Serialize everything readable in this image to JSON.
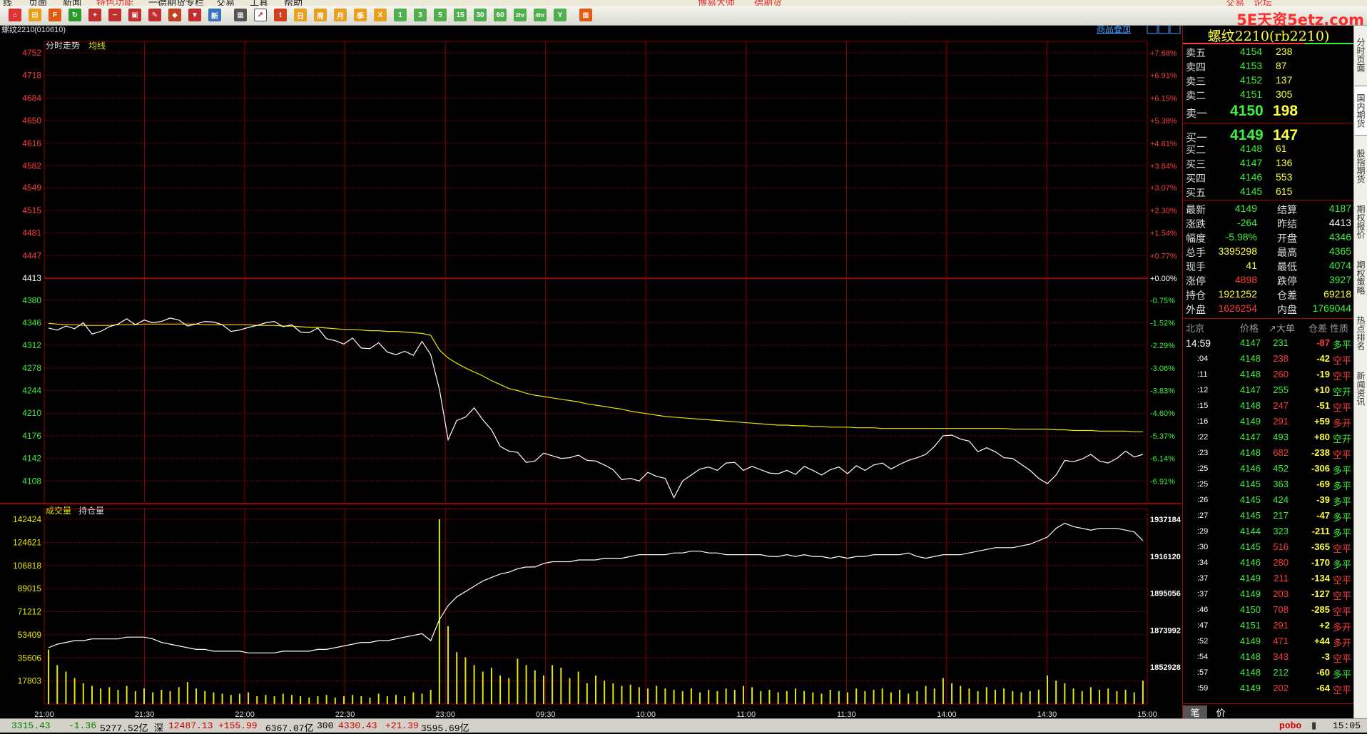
{
  "menubar": {
    "items": [
      "线",
      "页面",
      "新闻",
      "特色功能",
      "一德期货专栏",
      "交易",
      "工具",
      "帮助"
    ],
    "center": [
      "博易大师",
      "德期货"
    ],
    "right": [
      "交易",
      "论坛"
    ]
  },
  "toolbar": {
    "period_buttons": [
      "日",
      "周",
      "月",
      "季",
      "X",
      "1",
      "3",
      "5",
      "15",
      "30",
      "60",
      "2hr",
      "4hr",
      "Y"
    ],
    "watermark": "5E天资5etz.com"
  },
  "chart_header": {
    "symbol": "螺纹2210",
    "code": "(010610)",
    "overlay_link": "商品叠加",
    "price_pane_label": "分时走势",
    "avg_label": "均线",
    "volume_pane_label": "成交量",
    "oi_label": "持仓量"
  },
  "colors": {
    "up": "#ff3c3c",
    "down": "#3df03d",
    "grid": "#8b0000",
    "price_line": "#ffffff",
    "avg_line": "#e6e600",
    "volume_bar": "#e6e600"
  },
  "chart_data": [
    {
      "type": "line",
      "title": "分时走势",
      "x_ticks": [
        "21:00",
        "21:30",
        "22:00",
        "22:30",
        "23:00",
        "09:30",
        "10:00",
        "11:00",
        "11:30",
        "14:00",
        "14:30",
        "15:00"
      ],
      "y_ticks_left": [
        4752,
        4718,
        4684,
        4650,
        4616,
        4582,
        4549,
        4515,
        4481,
        4447,
        4413,
        4380,
        4346,
        4312,
        4278,
        4244,
        4210,
        4176,
        4142,
        4108
      ],
      "y_ticks_right": [
        "+7.68%",
        "+6.91%",
        "+6.15%",
        "+5.38%",
        "+4.61%",
        "+3.84%",
        "+3.07%",
        "+2.30%",
        "+1.54%",
        "+0.77%",
        "+0.00%",
        "-0.75%",
        "-1.52%",
        "-2.29%",
        "-3.06%",
        "-3.83%",
        "-4.60%",
        "-5.37%",
        "-6.14%",
        "-6.91%"
      ],
      "ylim": [
        4074,
        4752
      ],
      "reference": 4413,
      "series": [
        {
          "values": [
            4338,
            4335,
            4341,
            4337,
            4346,
            4329,
            4333,
            4340,
            4344,
            4352,
            4343,
            4350,
            4346,
            4348,
            4353,
            4350,
            4341,
            4344,
            4348,
            4347,
            4343,
            4333,
            4335,
            4339,
            4342,
            4346,
            4348,
            4340,
            4343,
            4332,
            4331,
            4338,
            4322,
            4319,
            4314,
            4323,
            4308,
            4307,
            4316,
            4302,
            4298,
            4303,
            4297,
            4318,
            4298,
            4246,
            4170,
            4199,
            4204,
            4218,
            4200,
            4185,
            4160,
            4153,
            4151,
            4136,
            4138,
            4150,
            4146,
            4142,
            4143,
            4147,
            4139,
            4138,
            4132,
            4125,
            4110,
            4112,
            4108,
            4121,
            4115,
            4112,
            4083,
            4108,
            4117,
            4126,
            4129,
            4124,
            4135,
            4136,
            4124,
            4130,
            4125,
            4120,
            4119,
            4124,
            4118,
            4130,
            4124,
            4117,
            4125,
            4129,
            4119,
            4131,
            4124,
            4132,
            4135,
            4126,
            4133,
            4139,
            4143,
            4148,
            4160,
            4176,
            4177,
            4171,
            4168,
            4152,
            4158,
            4152,
            4143,
            4142,
            4133,
            4124,
            4112,
            4104,
            4117,
            4139,
            4137,
            4141,
            4148,
            4138,
            4135,
            4142,
            4153,
            4144,
            4148
          ]
        },
        {
          "values": [
            4345,
            4344,
            4343,
            4343,
            4342,
            4342,
            4342,
            4342,
            4343,
            4343,
            4343,
            4344,
            4344,
            4344,
            4344,
            4344,
            4344,
            4344,
            4343,
            4343,
            4343,
            4343,
            4343,
            4343,
            4342,
            4342,
            4342,
            4341,
            4341,
            4340,
            4339,
            4339,
            4338,
            4337,
            4336,
            4336,
            4335,
            4334,
            4334,
            4333,
            4333,
            4332,
            4331,
            4330,
            4327,
            4305,
            4293,
            4285,
            4278,
            4272,
            4266,
            4259,
            4253,
            4247,
            4244,
            4240,
            4237,
            4235,
            4233,
            4231,
            4229,
            4227,
            4224,
            4222,
            4220,
            4218,
            4216,
            4213,
            4211,
            4209,
            4207,
            4205,
            4204,
            4203,
            4202,
            4201,
            4200,
            4199,
            4198,
            4197,
            4196,
            4195,
            4194,
            4193,
            4192,
            4192,
            4191,
            4191,
            4190,
            4190,
            4189,
            4189,
            4189,
            4188,
            4188,
            4188,
            4187,
            4187,
            4187,
            4187,
            4187,
            4187,
            4187,
            4187,
            4187,
            4187,
            4187,
            4187,
            4187,
            4187,
            4187,
            4186,
            4186,
            4186,
            4186,
            4186,
            4185,
            4185,
            4184,
            4184,
            4184,
            4183,
            4183,
            4183,
            4183,
            4182,
            4182
          ]
        }
      ]
    },
    {
      "type": "bar",
      "title": "成交量",
      "y_ticks_left": [
        142424,
        124621,
        106818,
        89015,
        71212,
        53409,
        35606,
        17803
      ],
      "y_ticks_right": [
        1937184,
        1916120,
        1895056,
        1873992,
        1852928
      ],
      "ylim": [
        0,
        142424
      ],
      "oi_ylim": [
        1831864,
        1937184
      ],
      "series": [
        {
          "name": "成交量",
          "values": [
            42000,
            30000,
            25000,
            20000,
            16000,
            14000,
            12000,
            13000,
            11000,
            14000,
            10000,
            12000,
            9000,
            11000,
            10000,
            13000,
            17000,
            12000,
            10000,
            9000,
            8000,
            7000,
            8000,
            9000,
            6000,
            7000,
            6000,
            8000,
            7000,
            6000,
            5000,
            6000,
            7000,
            5000,
            6000,
            7000,
            6000,
            5000,
            8000,
            6000,
            7000,
            6000,
            9000,
            8000,
            11000,
            142424,
            60000,
            40000,
            36000,
            30000,
            25000,
            28000,
            22000,
            20000,
            35000,
            30000,
            26000,
            22000,
            30000,
            28000,
            20000,
            25000,
            16000,
            22000,
            18000,
            16000,
            14000,
            15000,
            13000,
            12000,
            14000,
            12000,
            11000,
            10000,
            12000,
            9000,
            11000,
            10000,
            12000,
            11000,
            14000,
            13000,
            10000,
            11000,
            9000,
            10000,
            12000,
            10000,
            9000,
            8000,
            11000,
            10000,
            9000,
            12000,
            10000,
            11000,
            12000,
            9000,
            11000,
            8000,
            10000,
            14000,
            12000,
            20000,
            16000,
            14000,
            12000,
            10000,
            13000,
            11000,
            12000,
            10000,
            9000,
            10000,
            11000,
            22000,
            18000,
            16000,
            12000,
            10000,
            13000,
            11000,
            12000,
            10000,
            11000,
            9000,
            18000
          ]
        },
        {
          "name": "持仓量",
          "values": [
            1864000,
            1866000,
            1867000,
            1868000,
            1868000,
            1869000,
            1869000,
            1869000,
            1869000,
            1870000,
            1870000,
            1870000,
            1869000,
            1867000,
            1866000,
            1865000,
            1864000,
            1863000,
            1863000,
            1862000,
            1862000,
            1862000,
            1862000,
            1861000,
            1861000,
            1861000,
            1861000,
            1862000,
            1862000,
            1862000,
            1862000,
            1863000,
            1863000,
            1864000,
            1865000,
            1866000,
            1867000,
            1867000,
            1868000,
            1868000,
            1869000,
            1870000,
            1871000,
            1872000,
            1868000,
            1880000,
            1888000,
            1893000,
            1896000,
            1899000,
            1902000,
            1904000,
            1906000,
            1907000,
            1909000,
            1910000,
            1910000,
            1912000,
            1913000,
            1913000,
            1913000,
            1914000,
            1914000,
            1914000,
            1915000,
            1915000,
            1915000,
            1916000,
            1917000,
            1917000,
            1917000,
            1917000,
            1918000,
            1918000,
            1919000,
            1919000,
            1918000,
            1918000,
            1917000,
            1917000,
            1917000,
            1917000,
            1917000,
            1916000,
            1916000,
            1917000,
            1916000,
            1917000,
            1916000,
            1916000,
            1915000,
            1916000,
            1915000,
            1916000,
            1916000,
            1917000,
            1917000,
            1917000,
            1917000,
            1918000,
            1916000,
            1915000,
            1916000,
            1917000,
            1917000,
            1917000,
            1918000,
            1919000,
            1920000,
            1921000,
            1921000,
            1921000,
            1922000,
            1923000,
            1925000,
            1927000,
            1932000,
            1935000,
            1933000,
            1932000,
            1931000,
            1932000,
            1932000,
            1932000,
            1931000,
            1930000,
            1925000
          ]
        }
      ]
    }
  ],
  "panel": {
    "title": "螺纹2210(rb2210)",
    "asks": [
      {
        "label": "卖五",
        "price": "4154",
        "vol": "238"
      },
      {
        "label": "卖四",
        "price": "4153",
        "vol": "87"
      },
      {
        "label": "卖三",
        "price": "4152",
        "vol": "137"
      },
      {
        "label": "卖二",
        "price": "4151",
        "vol": "305"
      },
      {
        "label": "卖一",
        "price": "4150",
        "vol": "198"
      }
    ],
    "bids": [
      {
        "label": "买一",
        "price": "4149",
        "vol": "147"
      },
      {
        "label": "买二",
        "price": "4148",
        "vol": "61"
      },
      {
        "label": "买三",
        "price": "4147",
        "vol": "136"
      },
      {
        "label": "买四",
        "price": "4146",
        "vol": "553"
      },
      {
        "label": "买五",
        "price": "4145",
        "vol": "615"
      }
    ],
    "stats": [
      {
        "l1": "最新",
        "v1": "4149",
        "c1": "g",
        "l2": "结算",
        "v2": "4187",
        "c2": "g"
      },
      {
        "l1": "涨跌",
        "v1": "-264",
        "c1": "g",
        "l2": "昨结",
        "v2": "4413",
        "c2": "w"
      },
      {
        "l1": "幅度",
        "v1": "-5.98%",
        "c1": "g",
        "l2": "开盘",
        "v2": "4346",
        "c2": "g"
      },
      {
        "l1": "总手",
        "v1": "3395298",
        "c1": "y",
        "l2": "最高",
        "v2": "4365",
        "c2": "g"
      },
      {
        "l1": "现手",
        "v1": "41",
        "c1": "y",
        "l2": "最低",
        "v2": "4074",
        "c2": "g"
      },
      {
        "l1": "涨停",
        "v1": "4898",
        "c1": "r",
        "l2": "跌停",
        "v2": "3927",
        "c2": "g"
      },
      {
        "l1": "持仓",
        "v1": "1921252",
        "c1": "y",
        "l2": "仓差",
        "v2": "69218",
        "c2": "y"
      },
      {
        "l1": "外盘",
        "v1": "1626254",
        "c1": "r",
        "l2": "内盘",
        "v2": "1769044",
        "c2": "g"
      }
    ],
    "tick_headers": [
      "北京",
      "价格",
      "↗大单",
      "仓差",
      "性质"
    ],
    "ticks": [
      {
        "t": "14:59",
        "p": "4147",
        "v": "231",
        "vc": "g",
        "d": "-87",
        "dc": "r",
        "n": "多平",
        "nc": "g"
      },
      {
        "t": ":04",
        "p": "4148",
        "v": "238",
        "vc": "r",
        "d": "-42",
        "dc": "y",
        "n": "空平",
        "nc": "r"
      },
      {
        "t": ":11",
        "p": "4148",
        "v": "260",
        "vc": "r",
        "d": "-19",
        "dc": "y",
        "n": "空平",
        "nc": "r"
      },
      {
        "t": ":12",
        "p": "4147",
        "v": "255",
        "vc": "g",
        "d": "+10",
        "dc": "y",
        "n": "空开",
        "nc": "g"
      },
      {
        "t": ":15",
        "p": "4148",
        "v": "247",
        "vc": "r",
        "d": "-51",
        "dc": "y",
        "n": "空平",
        "nc": "r"
      },
      {
        "t": ":16",
        "p": "4149",
        "v": "291",
        "vc": "r",
        "d": "+59",
        "dc": "y",
        "n": "多开",
        "nc": "r"
      },
      {
        "t": ":22",
        "p": "4147",
        "v": "493",
        "vc": "g",
        "d": "+80",
        "dc": "y",
        "n": "空开",
        "nc": "g"
      },
      {
        "t": ":23",
        "p": "4148",
        "v": "682",
        "vc": "r",
        "d": "-238",
        "dc": "y",
        "n": "空平",
        "nc": "r"
      },
      {
        "t": ":25",
        "p": "4146",
        "v": "452",
        "vc": "g",
        "d": "-306",
        "dc": "y",
        "n": "多平",
        "nc": "g"
      },
      {
        "t": ":25",
        "p": "4145",
        "v": "363",
        "vc": "g",
        "d": "-69",
        "dc": "y",
        "n": "多平",
        "nc": "g"
      },
      {
        "t": ":26",
        "p": "4145",
        "v": "424",
        "vc": "g",
        "d": "-39",
        "dc": "y",
        "n": "多平",
        "nc": "g"
      },
      {
        "t": ":27",
        "p": "4145",
        "v": "217",
        "vc": "g",
        "d": "-47",
        "dc": "y",
        "n": "多平",
        "nc": "g"
      },
      {
        "t": ":29",
        "p": "4144",
        "v": "323",
        "vc": "g",
        "d": "-211",
        "dc": "y",
        "n": "多平",
        "nc": "g"
      },
      {
        "t": ":30",
        "p": "4145",
        "v": "516",
        "vc": "r",
        "d": "-365",
        "dc": "y",
        "n": "空平",
        "nc": "r"
      },
      {
        "t": ":34",
        "p": "4146",
        "v": "280",
        "vc": "r",
        "d": "-170",
        "dc": "y",
        "n": "多平",
        "nc": "g"
      },
      {
        "t": ":37",
        "p": "4149",
        "v": "211",
        "vc": "r",
        "d": "-134",
        "dc": "y",
        "n": "空平",
        "nc": "r"
      },
      {
        "t": ":37",
        "p": "4149",
        "v": "203",
        "vc": "r",
        "d": "-127",
        "dc": "y",
        "n": "空平",
        "nc": "r"
      },
      {
        "t": ":46",
        "p": "4150",
        "v": "708",
        "vc": "r",
        "d": "-285",
        "dc": "y",
        "n": "空平",
        "nc": "r"
      },
      {
        "t": ":47",
        "p": "4151",
        "v": "291",
        "vc": "r",
        "d": "+2",
        "dc": "y",
        "n": "多开",
        "nc": "r"
      },
      {
        "t": ":52",
        "p": "4149",
        "v": "471",
        "vc": "r",
        "d": "+44",
        "dc": "y",
        "n": "多开",
        "nc": "r"
      },
      {
        "t": ":54",
        "p": "4148",
        "v": "343",
        "vc": "r",
        "d": "-3",
        "dc": "y",
        "n": "空平",
        "nc": "r"
      },
      {
        "t": ":57",
        "p": "4148",
        "v": "212",
        "vc": "g",
        "d": "-60",
        "dc": "y",
        "n": "多平",
        "nc": "g"
      },
      {
        "t": ":59",
        "p": "4149",
        "v": "202",
        "vc": "r",
        "d": "-64",
        "dc": "y",
        "n": "空平",
        "nc": "r"
      }
    ],
    "bottom_tabs": [
      "笔",
      "价"
    ]
  },
  "sidebar": [
    "分时页面",
    "国内期货",
    "股指期货",
    "期权报价",
    "期权策略",
    "热点排名",
    "新闻资讯"
  ],
  "statusbar": {
    "items": [
      {
        "t": "3315.43",
        "c": "#008000"
      },
      {
        "t": "-1.36",
        "c": "#008000"
      },
      {
        "t": "5277.52亿",
        "c": "#000"
      },
      {
        "t": "深",
        "c": "#000"
      },
      {
        "t": "12487.13",
        "c": "#c00"
      },
      {
        "t": "+155.99",
        "c": "#c00"
      },
      {
        "t": "6367.07亿",
        "c": "#000"
      },
      {
        "t": "300",
        "c": "#000"
      },
      {
        "t": "4330.43",
        "c": "#c00"
      },
      {
        "t": "+21.39",
        "c": "#c00"
      },
      {
        "t": "3595.69亿",
        "c": "#000"
      }
    ],
    "right_brand": "pobo",
    "clock": "15:05"
  }
}
